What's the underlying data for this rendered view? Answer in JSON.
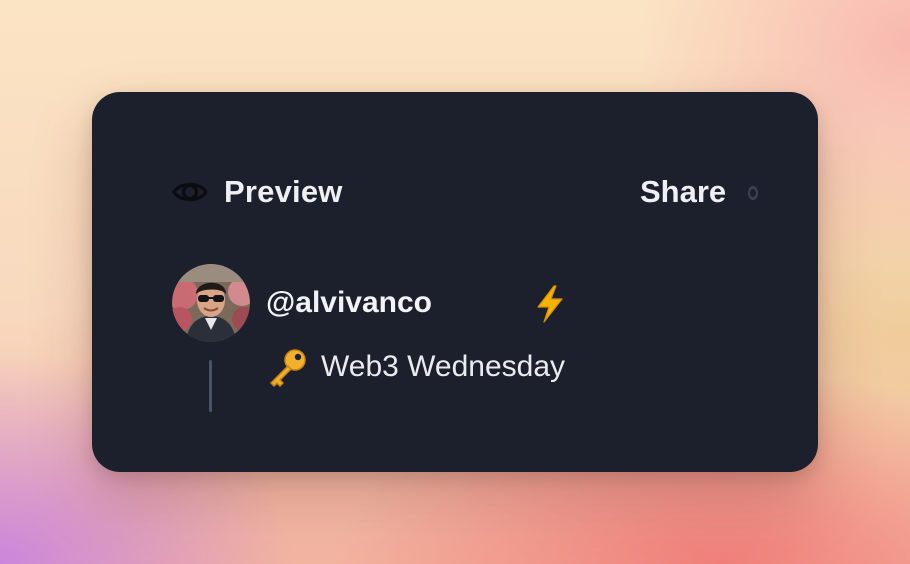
{
  "preview": {
    "title": "Preview",
    "icon": "eye-icon"
  },
  "share": {
    "label": "Share"
  },
  "post": {
    "username": "@alvivanco",
    "username_icon": "lightning-bolt-icon",
    "message_icon": "key-icon",
    "message": "Web3 Wednesday"
  },
  "colors": {
    "card_background": "#1b202c",
    "text": "#eef0f4",
    "thread_line": "#4a5468",
    "bolt": "#f5b400",
    "key": "#f2b12d"
  }
}
